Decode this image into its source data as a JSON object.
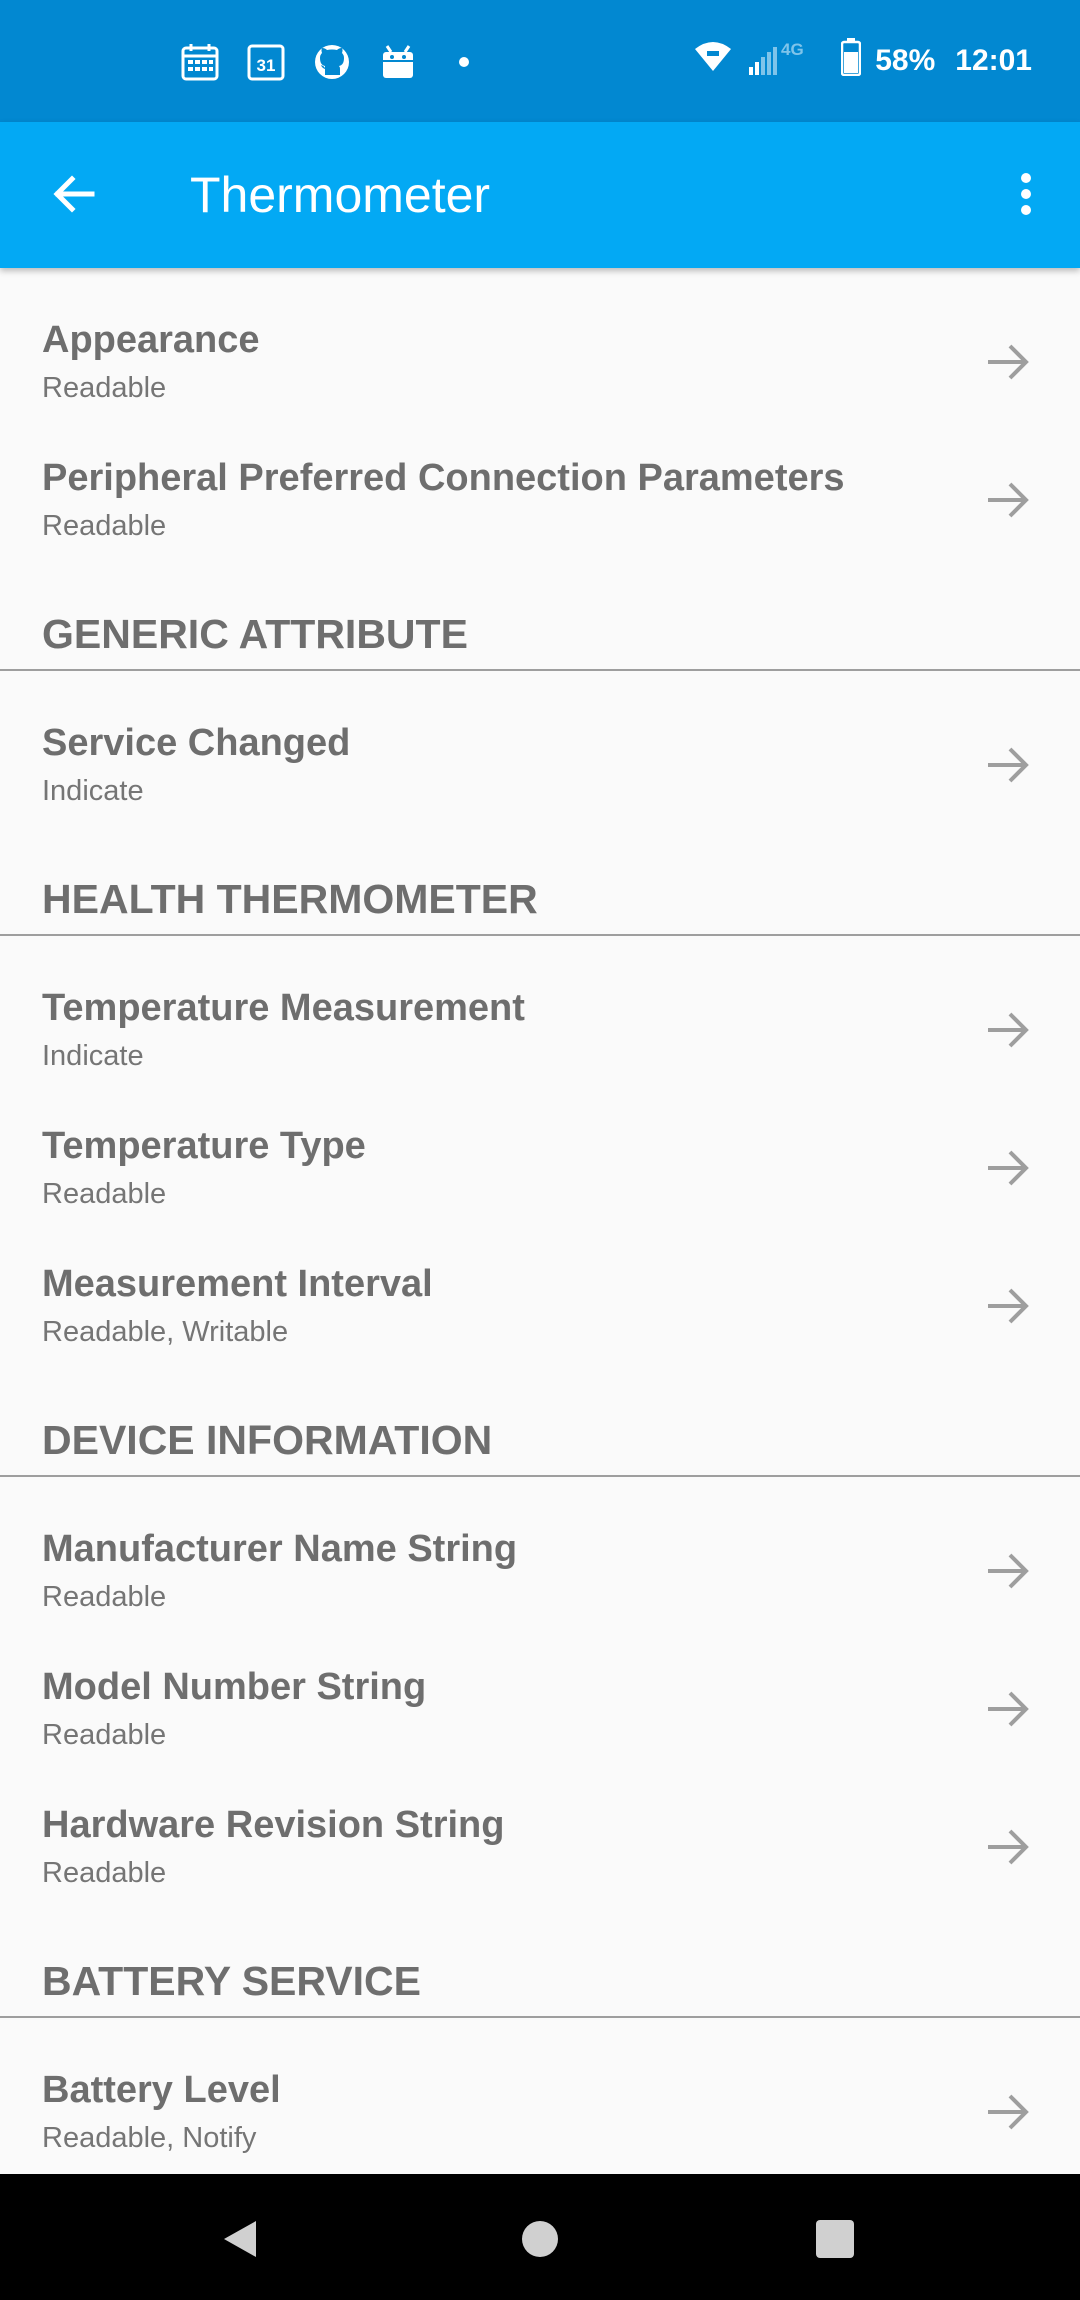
{
  "status_bar": {
    "battery": "58%",
    "time": "12:01",
    "network": "4G",
    "left_icons": [
      "calendar-icon",
      "calendar-31-icon",
      "github-icon",
      "android-icon",
      "dot-icon"
    ],
    "calendar_day": "31"
  },
  "app_bar": {
    "title": "Thermometer",
    "back_icon": "arrow-left-icon",
    "menu_icon": "more-vert-icon"
  },
  "list": [
    {
      "kind": "item",
      "name": "Appearance",
      "props": "Readable"
    },
    {
      "kind": "item",
      "name": "Peripheral Preferred Connection Parameters",
      "props": "Readable"
    },
    {
      "kind": "header",
      "label": "GENERIC ATTRIBUTE"
    },
    {
      "kind": "item",
      "name": "Service Changed",
      "props": "Indicate"
    },
    {
      "kind": "header",
      "label": "HEALTH THERMOMETER"
    },
    {
      "kind": "item",
      "name": "Temperature Measurement",
      "props": "Indicate"
    },
    {
      "kind": "item",
      "name": "Temperature Type",
      "props": "Readable"
    },
    {
      "kind": "item",
      "name": "Measurement Interval",
      "props": "Readable, Writable"
    },
    {
      "kind": "header",
      "label": "DEVICE INFORMATION"
    },
    {
      "kind": "item",
      "name": "Manufacturer Name String",
      "props": "Readable"
    },
    {
      "kind": "item",
      "name": "Model Number String",
      "props": "Readable"
    },
    {
      "kind": "item",
      "name": "Hardware Revision String",
      "props": "Readable"
    },
    {
      "kind": "header",
      "label": "BATTERY SERVICE"
    },
    {
      "kind": "item",
      "name": "Battery Level",
      "props": "Readable, Notify"
    }
  ],
  "colors": {
    "status_bar": "#0288d1",
    "app_bar": "#03a9f4",
    "background": "#fafafa",
    "text": "#6e6e6e",
    "arrow": "#9e9e9e"
  },
  "nav_bar": [
    "back-triangle-icon",
    "home-circle-icon",
    "recents-square-icon"
  ]
}
